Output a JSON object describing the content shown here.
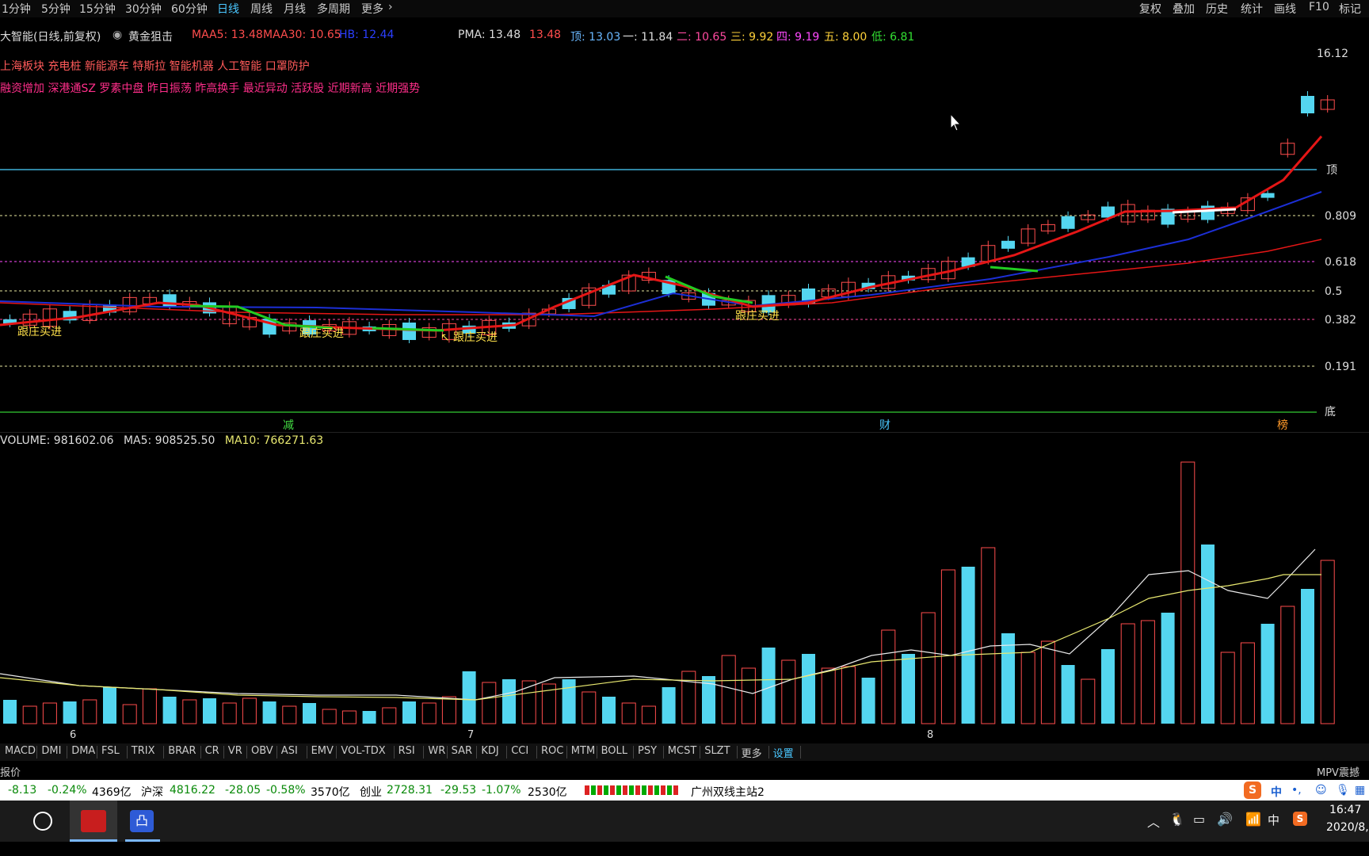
{
  "topbar": {
    "periods": [
      "1分钟",
      "5分钟",
      "15分钟",
      "30分钟",
      "60分钟",
      "日线",
      "周线",
      "月线",
      "多周期",
      "更多"
    ],
    "active": "日线",
    "right_menu": [
      "复权",
      "叠加",
      "历史",
      "统计",
      "画线",
      "F10",
      "标记"
    ]
  },
  "legend": {
    "stock": "大智能(日线,前复权)",
    "indicator": "黄金狙击",
    "maa5": "MAA5: 13.48",
    "maa30": "MAA30: 10.65",
    "hb": "HB: 12.44",
    "pma": "PMA: 13.48",
    "pma_val": "13.48",
    "top": "顶: 13.03",
    "one": "一: 11.84",
    "two": "二: 10.65",
    "three": "三: 9.92",
    "four": "四: 9.19",
    "five": "五: 8.00",
    "low": "低: 6.81"
  },
  "tags": {
    "line1": "上海板块 充电桩 新能源车 特斯拉 智能机器 人工智能 口罩防护",
    "line2": "融资增加 深港通SZ 罗素中盘 昨日振荡 昨高换手 最近异动 活跃股 近期新高 近期强势"
  },
  "price_levels": {
    "max_label": "16.12",
    "top": "顶",
    "l0809": "0.809",
    "l0618": "0.618",
    "l05": "0.5",
    "l0382": "0.382",
    "l0191": "0.191",
    "bottom": "底"
  },
  "signals": [
    "跟庄买进",
    "跟庄买进",
    "跟庄买进",
    "跟庄买进"
  ],
  "signal_prefix": "↖",
  "event_marks": [
    "减",
    "财",
    "榜"
  ],
  "volume_legend": {
    "vol": "VOLUME: 981602.06",
    "ma5": "MA5: 908525.50",
    "ma10": "MA10: 766271.63"
  },
  "month_labels": [
    "6",
    "7",
    "8"
  ],
  "indicators": [
    "MACD",
    "DMI",
    "DMA",
    "FSL",
    "TRIX",
    "BRAR",
    "CR",
    "VR",
    "OBV",
    "ASI",
    "EMV",
    "VOL-TDX",
    "RSI",
    "WR",
    "SAR",
    "KDJ",
    "CCI",
    "ROC",
    "MTM",
    "BOLL",
    "PSY",
    "MCST",
    "SLZT",
    "更多",
    "设置"
  ],
  "indicator_active": "设置",
  "info_left": "报价",
  "info_right": "MPV震撼",
  "market": {
    "sh_chg": "-8.13",
    "sh_pct": "-0.24%",
    "sh_amt": "4369亿",
    "hs_label": "沪深",
    "hs_val": "4816.22",
    "hs_chg": "-28.05",
    "hs_pct": "-0.58%",
    "hs_amt": "3570亿",
    "cy_label": "创业",
    "cy_val": "2728.31",
    "cy_chg": "-29.53",
    "cy_pct": "-1.07%",
    "cy_amt": "2530亿",
    "server": "广州双线主站2"
  },
  "clock": {
    "time": "16:47",
    "date": "2020/8,"
  },
  "colors": {
    "up": "#ff4d4d",
    "down": "#54d6f0",
    "ma_red": "#e51616",
    "ma_blue": "#1c2fd6",
    "accent": "#4ac7ff"
  },
  "chart_data": {
    "type": "candlestick",
    "y_labels": [
      "16.12",
      "0.809",
      "0.618",
      "0.5",
      "0.382",
      "0.191"
    ],
    "month_ticks": [
      "6",
      "7",
      "8"
    ],
    "volume_max_label": "981602.06"
  }
}
